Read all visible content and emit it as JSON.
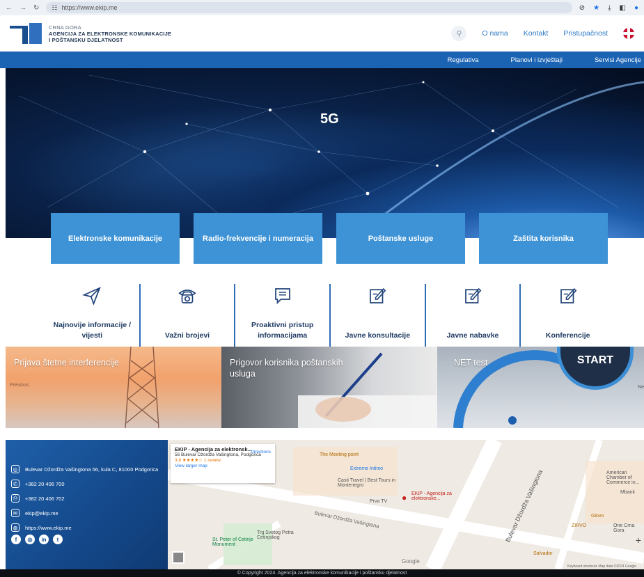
{
  "browser": {
    "url": "https://www.ekip.me"
  },
  "header": {
    "logo_line1": "CRNA GORA",
    "logo_line2": "AGENCIJA ZA ELEKTRONSKE KOMUNIKACIJE",
    "logo_line3": "I POŠTANSKU DJELATNOST",
    "links": [
      "O nama",
      "Kontakt",
      "Pristupačnost"
    ]
  },
  "mainnav": [
    "Regulativa",
    "Planovi i izvještaji",
    "Servisi Agencije"
  ],
  "hero": {
    "title": "5G"
  },
  "tiles": [
    "Elektronske komunikacije",
    "Radio-frekvencije i numeracija",
    "Poštanske usluge",
    "Zaštita korisnika"
  ],
  "quick_links": [
    {
      "label": "Najnovije informacije / vijesti",
      "icon": "paper-plane-icon"
    },
    {
      "label": "Važni brojevi",
      "icon": "telephone-icon"
    },
    {
      "label": "Proaktivni pristup informacijama",
      "icon": "message-icon"
    },
    {
      "label": "Javne konsultacije",
      "icon": "edit-icon"
    },
    {
      "label": "Javne nabavke",
      "icon": "edit-icon"
    },
    {
      "label": "Konferencije",
      "icon": "edit-icon"
    }
  ],
  "promos": {
    "p1": "Prijava štetne interferencije",
    "p1_prev": "Previous",
    "p2": "Prigovor korisnika poštanskih usluga",
    "p3": "NET test",
    "p3_start": "START",
    "p3_next": "Ne"
  },
  "contact": {
    "address": "Bulevar Džordža Vašingtona 56, kula C, 81000 Podgorica",
    "phone1": "+382 20 406 700",
    "phone2": "+382 20 406 702",
    "email": "ekip@ekip.me",
    "web": "https://www.ekip.me"
  },
  "map": {
    "card_title": "EKIP - Agencija za elektronsk...",
    "card_addr": "56 Bulevar Džordža Vašingtona, Podgorica",
    "card_rating": "3.8 ★★★★☆  1 review",
    "card_link": "View larger map",
    "directions": "Directions",
    "labels": [
      "The Meeting point",
      "Extreme Intimo",
      "Casti Travel | Best Tours in Montenegro",
      "Prva TV",
      "EKIP - Agencija za elektronske...",
      "Bulevar Džordža Vašingtona",
      "Trg Svetog Petra Cetinjskog",
      "St. Peter of Cetinje Monument",
      "American Chamber of Commerce in...",
      "Mbank",
      "Giovo",
      "ZIRVO",
      "One Crna Gora",
      "Salvador",
      "Google",
      "Keyboard shortcuts   Map data ©2024 Google"
    ]
  },
  "copyright": "© Copyright 2024. Agencija za elektronske komunikacije i poštansku djelatnost"
}
